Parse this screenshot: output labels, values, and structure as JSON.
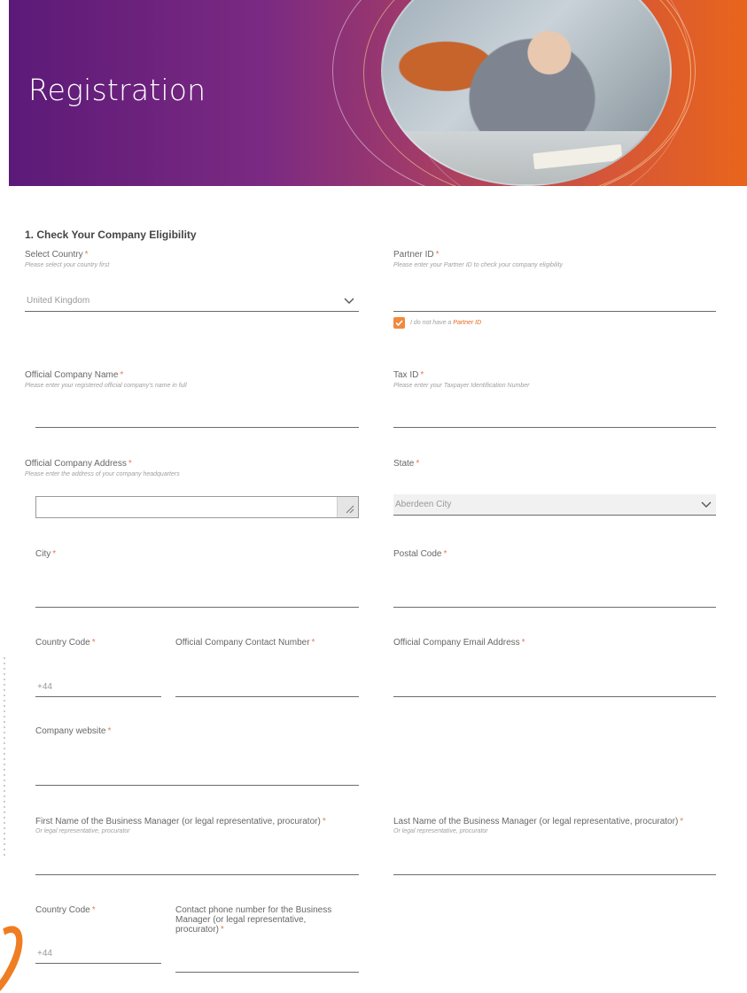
{
  "header": {
    "title": "Registration"
  },
  "section": {
    "title": "1. Check Your Company Eligibility"
  },
  "fields": {
    "country": {
      "label": "Select Country",
      "hint": "Please select your country first",
      "value": "United Kingdom"
    },
    "partner_id": {
      "label": "Partner ID",
      "hint": "Please enter your Partner ID to check your company eligibility",
      "value": ""
    },
    "no_partner": {
      "text": "I do not have a",
      "accent": "Partner ID",
      "checked": true
    },
    "company_name": {
      "label": "Official Company Name",
      "hint": "Please enter your registered official company's name in full",
      "value": ""
    },
    "tax_id": {
      "label": "Tax ID",
      "hint": "Please enter your Taxpayer Identification Number",
      "value": ""
    },
    "company_address": {
      "label": "Official Company Address",
      "hint": "Please enter the address of your company headquarters",
      "value": ""
    },
    "state": {
      "label": "State",
      "value": "Aberdeen City"
    },
    "city": {
      "label": "City",
      "value": ""
    },
    "postal_code": {
      "label": "Postal Code",
      "value": ""
    },
    "country_code_1": {
      "label": "Country Code",
      "value": "+44"
    },
    "contact_number": {
      "label": "Official Company Contact Number",
      "value": ""
    },
    "email": {
      "label": "Official Company Email Address",
      "value": ""
    },
    "website": {
      "label": "Company website",
      "value": ""
    },
    "manager_first": {
      "label": "First Name of the Business Manager (or legal representative, procurator)",
      "hint": "Or legal representative, procurator",
      "value": ""
    },
    "manager_last": {
      "label": "Last Name of the Business Manager (or legal representative, procurator)",
      "hint": "Or legal representative, procurator",
      "value": ""
    },
    "country_code_2": {
      "label": "Country Code",
      "value": "+44"
    },
    "manager_phone": {
      "label": "Contact phone number for the Business Manager (or legal representative, procurator)",
      "value": ""
    }
  },
  "required_mark": "*",
  "colors": {
    "accent": "#e8651c",
    "brand_purple": "#5c1a78",
    "required": "#e87a5a"
  },
  "icons": {
    "chevron": "chevron-down-icon",
    "check": "check-icon"
  }
}
